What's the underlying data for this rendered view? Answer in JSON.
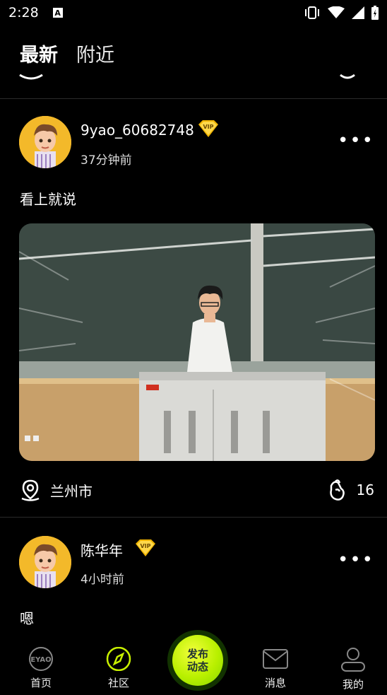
{
  "status_bar": {
    "time": "2:28",
    "notification_icon": "A"
  },
  "tabs": [
    {
      "label": "最新",
      "active": true
    },
    {
      "label": "附近",
      "active": false
    }
  ],
  "posts": [
    {
      "user": "9yao_60682748",
      "badge": "VIP",
      "time": "37分钟前",
      "text": "看上就说",
      "location": "兰州市",
      "likes": "16"
    },
    {
      "user": "陈华年",
      "badge": "VIP",
      "time": "4小时前",
      "text": "嗯"
    }
  ],
  "bottom_nav": {
    "home": "首页",
    "community": "社区",
    "publish_line1": "发布",
    "publish_line2": "动态",
    "messages": "消息",
    "mine": "我的"
  },
  "colors": {
    "accent": "#c8f000",
    "badge": "#f0b400",
    "background": "#000000"
  }
}
